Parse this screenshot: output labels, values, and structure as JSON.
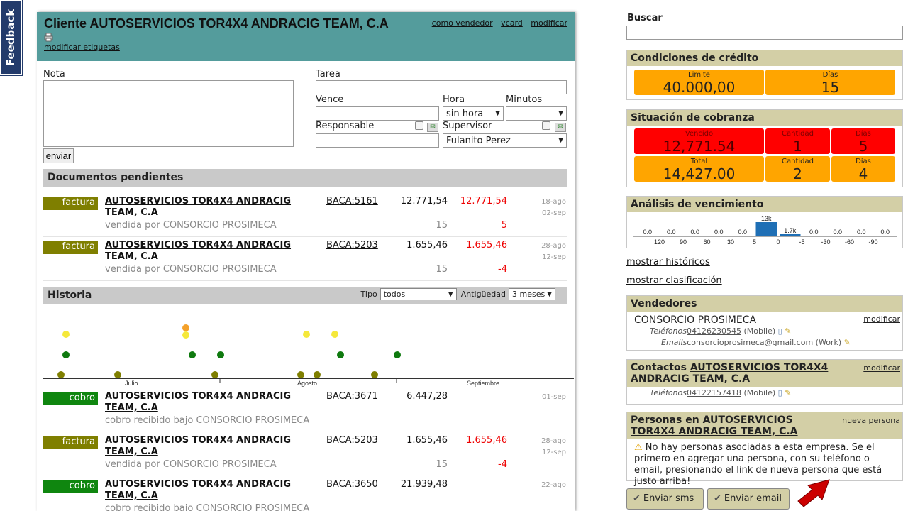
{
  "feedback": "Feedback",
  "client": {
    "title": "Cliente AUTOSERVICIOS TOR4X4 ANDRACIG TEAM, C.A",
    "links": [
      "como vendedor",
      "vcard",
      "modificar"
    ],
    "print_icon": "printer-icon",
    "tags_link": "modificar etiquetas"
  },
  "note_form": {
    "nota_label": "Nota",
    "tarea_label": "Tarea",
    "vence_label": "Vence",
    "hora_label": "Hora",
    "hora_value": "sin hora",
    "minutos_label": "Minutos",
    "minutos_value": "",
    "responsable_label": "Responsable",
    "supervisor_label": "Supervisor",
    "supervisor_value": "Fulanito Perez",
    "submit": "enviar"
  },
  "pending": {
    "title": "Documentos pendientes",
    "rows": [
      {
        "tag": "factura",
        "name": "AUTOSERVICIOS TOR4X4 ANDRACIG TEAM, C.A",
        "sub_prefix": "vendida por",
        "sub_link": "CONSORCIO PROSIMECA",
        "code": "BACA:5161",
        "amount": "12.771,54",
        "balance": "12.771,54",
        "n1": "15",
        "n2": "5",
        "d1": "18-ago",
        "d2": "02-sep"
      },
      {
        "tag": "factura",
        "name": "AUTOSERVICIOS TOR4X4 ANDRACIG TEAM, C.A",
        "sub_prefix": "vendida por",
        "sub_link": "CONSORCIO PROSIMECA",
        "code": "BACA:5203",
        "amount": "1.655,46",
        "balance": "1.655,46",
        "n1": "15",
        "n2": "-4",
        "d1": "28-ago",
        "d2": "12-sep"
      }
    ]
  },
  "history": {
    "title": "Historia",
    "tipo_label": "Tipo",
    "tipo_value": "todos",
    "antig_label": "Antigüedad",
    "antig_value": "3 meses",
    "months": [
      "Julio",
      "Agosto",
      "Septiembre"
    ],
    "rows": [
      {
        "tag": "cobro",
        "name": "AUTOSERVICIOS TOR4X4 ANDRACIG TEAM, C.A",
        "sub_prefix": "cobro recibido bajo",
        "sub_link": "CONSORCIO PROSIMECA",
        "code": "BACA:3671",
        "amount": "6.447,28",
        "balance": "",
        "n1": "",
        "n2": "",
        "d1": "01-sep",
        "d2": ""
      },
      {
        "tag": "factura",
        "name": "AUTOSERVICIOS TOR4X4 ANDRACIG TEAM, C.A",
        "sub_prefix": "vendida por",
        "sub_link": "CONSORCIO PROSIMECA",
        "code": "BACA:5203",
        "amount": "1.655,46",
        "balance": "1.655,46",
        "n1": "15",
        "n2": "-4",
        "d1": "28-ago",
        "d2": "12-sep"
      },
      {
        "tag": "cobro",
        "name": "AUTOSERVICIOS TOR4X4 ANDRACIG TEAM, C.A",
        "sub_prefix": "cobro recibido bajo",
        "sub_link": "CONSORCIO PROSIMECA",
        "code": "BACA:3650",
        "amount": "21.939,48",
        "balance": "",
        "n1": "",
        "n2": "",
        "d1": "22-ago",
        "d2": ""
      }
    ]
  },
  "search": {
    "label": "Buscar",
    "value": ""
  },
  "credit": {
    "title": "Condiciones de crédito",
    "tiles": [
      {
        "label": "Limite",
        "value": "40.000,00"
      },
      {
        "label": "Días",
        "value": "15"
      }
    ]
  },
  "collection": {
    "title": "Situación de cobranza",
    "overdue": [
      {
        "label": "Vencido",
        "value": "12,771.54"
      },
      {
        "label": "Cantidad",
        "value": "1"
      },
      {
        "label": "Días",
        "value": "5"
      }
    ],
    "total": [
      {
        "label": "Total",
        "value": "14,427.00"
      },
      {
        "label": "Cantidad",
        "value": "2"
      },
      {
        "label": "Días",
        "value": "4"
      }
    ]
  },
  "aging": {
    "title": "Análisis de vencimiento"
  },
  "chart_data": {
    "type": "bar",
    "categories": [
      "120",
      "90",
      "60",
      "30",
      "5",
      "0",
      "-5",
      "-30",
      "-60",
      "-90"
    ],
    "value_labels": [
      "0.0",
      "0.0",
      "0.0",
      "0.0",
      "0.0",
      "13k",
      "1.7k",
      "0.0",
      "0.0",
      "0.0",
      "0.0"
    ],
    "values": [
      0,
      0,
      0,
      0,
      0,
      13000,
      1700,
      0,
      0,
      0,
      0
    ],
    "color": "#1f6fb5"
  },
  "links": {
    "historicos": "mostrar históricos",
    "clasificacion": "mostrar clasificación"
  },
  "sellers": {
    "title": "Vendedores",
    "modify": "modificar",
    "name": "CONSORCIO PROSIMECA",
    "phones_label": "Teléfonos",
    "phone": "04126230545",
    "phone_type": "(Mobile)",
    "emails_label": "Emails",
    "email": "consorcioprosimeca@gmail.com",
    "email_type": "(Work)"
  },
  "contacts": {
    "title_prefix": "Contactos",
    "title_link": "AUTOSERVICIOS TOR4X4 ANDRACIG TEAM, C.A",
    "modify": "modificar",
    "phones_label": "Teléfonos",
    "phone": "04122157418",
    "phone_type": "(Mobile)"
  },
  "people": {
    "title_prefix": "Personas en",
    "title_link": "AUTOSERVICIOS TOR4X4 ANDRACIG TEAM, C.A",
    "new_link": "nueva persona",
    "message": "No hay personas asociadas a esta empresa. Se el primero en agregar una persona, con su teléfono o email, presionando el link de nueva persona que está justo arriba!"
  },
  "actions": {
    "sms": "Enviar sms",
    "email": "Enviar email"
  },
  "colors": {
    "header_teal": "#549c9c",
    "factura": "#7f7f00",
    "cobro": "#0f860f",
    "orange": "#ffa500",
    "red": "#ff0000",
    "panel_header": "#d3cfa6",
    "arrow": "#cc0000"
  }
}
